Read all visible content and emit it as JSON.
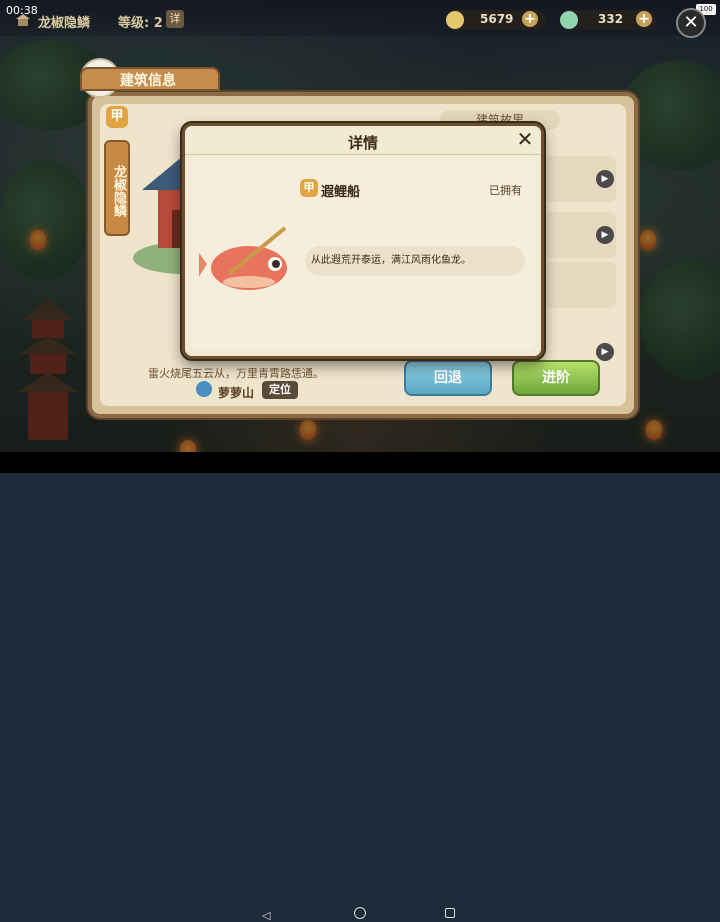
{
  "status_bar": {
    "time": "00:38",
    "battery": "100"
  },
  "top_bar": {
    "location_name": "龙椒隐鳞",
    "level_label": "等级: 2",
    "detail_button": "详",
    "resources": [
      {
        "icon": "coin-icon",
        "value": "5679",
        "color": "#e2c86a"
      },
      {
        "icon": "jade-icon",
        "value": "332",
        "color": "#8fd6b0"
      }
    ],
    "plus_label": "+",
    "close_label": "✕"
  },
  "building_panel": {
    "tab_title": "建筑信息",
    "rank_badge": "甲",
    "vertical_name": "龙椒隐鳞",
    "story_tab": "建筑故里",
    "verse": "雷火烧尾五云从，万里青霄路恁通。",
    "mount_name": "萝萝山",
    "locate_button": "定位",
    "back_button": "回退",
    "advance_button": "进阶",
    "play_icon": "▶"
  },
  "detail_modal": {
    "title": "详情",
    "close_label": "✕",
    "item_badge": "甲",
    "item_name": "遐鲤船",
    "status": "已拥有",
    "description": "从此遐荒开泰运，满江风雨化鱼龙。"
  },
  "nav_bar": {
    "back": "◁",
    "home": "home-icon",
    "recent": "recent-apps-icon"
  }
}
